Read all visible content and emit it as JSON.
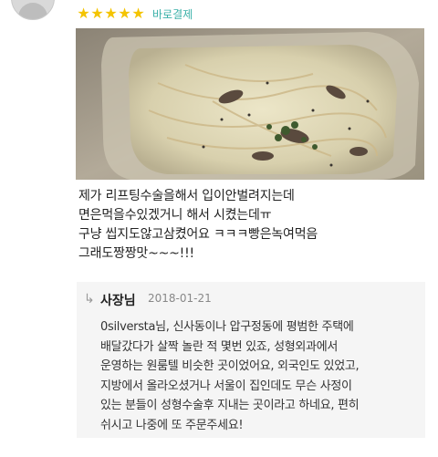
{
  "review": {
    "rating": 5,
    "stars": [
      "★",
      "★",
      "★",
      "★",
      "★"
    ],
    "payment_badge": "바로결제",
    "text": "제가 리프팅수술을해서 입이안벌려지는데\n면은먹을수있겠거니 해서 시켰는데ㅠ\n구냥 씹지도않고삼켰어요 ㅋㅋㅋ빵은녹여먹음\n그래도짱짱맛~~~!!!"
  },
  "owner_reply": {
    "arrow": "↳",
    "label": "사장님",
    "date": "2018-01-21",
    "text": "0silversta님, 신사동이나 압구정동에 평범한 주택에\n배달갔다가 살짝 놀란 적 몇번 있죠, 성형외과에서\n운영하는 원룸텔 비슷한 곳이었어요, 외국인도 있었고,\n지방에서 올라오셨거나 서울이 집인데도 무슨 사정이\n있는 분들이 성형수술후 지내는 곳이라고 하네요, 편히\n쉬시고 나중에 또 주문주세요!"
  },
  "colors": {
    "star": "#f4c400",
    "payment_badge": "#39b0a8",
    "reply_background": "#f5f5f5"
  }
}
